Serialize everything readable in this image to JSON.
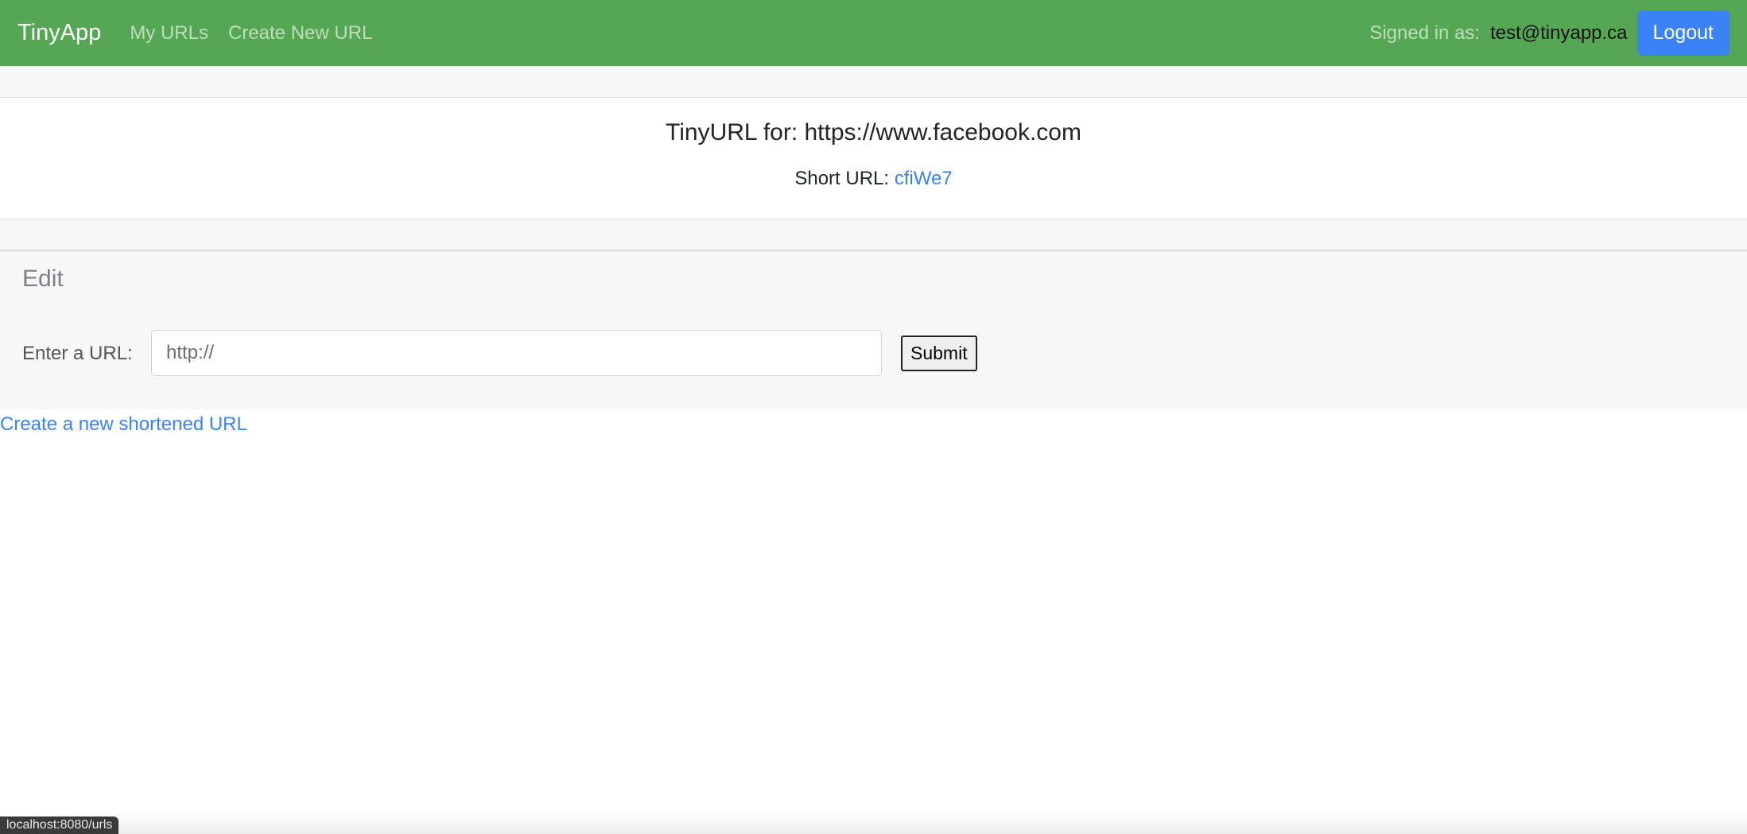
{
  "navbar": {
    "brand": "TinyApp",
    "links": [
      {
        "label": "My URLs"
      },
      {
        "label": "Create New URL"
      }
    ],
    "signed_in_label": "Signed in as:",
    "user_email": "test@tinyapp.ca",
    "logout_label": "Logout",
    "color": "#55a753"
  },
  "info": {
    "title": "TinyURL for: https://www.facebook.com",
    "short_label": "Short URL:",
    "short_code": "cfiWe7"
  },
  "edit": {
    "title": "Edit",
    "url_label": "Enter a URL:",
    "url_placeholder": "http://",
    "url_value": "",
    "submit_label": "Submit"
  },
  "footer": {
    "create_link": "Create a new shortened URL"
  },
  "status_bar": {
    "hover_url": "localhost:8080/urls"
  },
  "colors": {
    "link": "#3b82f6",
    "button_primary": "#3b82f6"
  }
}
